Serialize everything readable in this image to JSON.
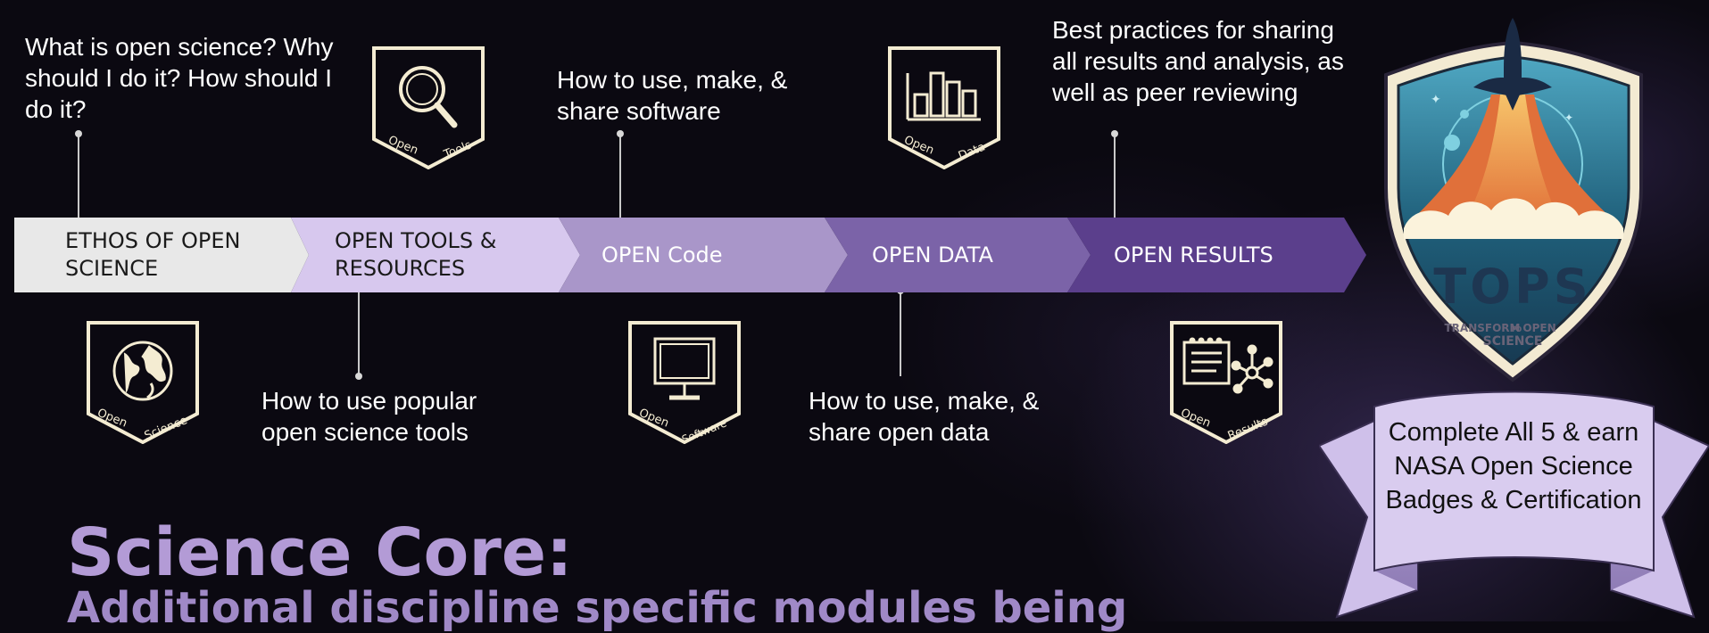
{
  "descriptions": {
    "ethos": "What is open science? Why should I do it? How should I do it?",
    "tools": "How to use popular open science tools",
    "code": "How to use, make, & share software",
    "data": "How to use, make, & share open data",
    "results": "Best practices for sharing all results and analysis, as well as peer reviewing"
  },
  "steps": [
    {
      "label_line1": "ETHOS OF OPEN",
      "label_line2": "SCIENCE",
      "color": "#e8e8e8",
      "text_color": "#1a1a1a"
    },
    {
      "label_line1": "OPEN TOOLS &",
      "label_line2": "RESOURCES",
      "color": "#d7c8ee",
      "text_color": "#1a1a1a"
    },
    {
      "label": "OPEN Code",
      "color": "#a996c9",
      "text_color": "#ffffff"
    },
    {
      "label": "OPEN DATA",
      "color": "#7b63a8",
      "text_color": "#ffffff"
    },
    {
      "label": "OPEN RESULTS",
      "color": "#5b3f8c",
      "text_color": "#ffffff"
    }
  ],
  "badges": {
    "science": {
      "word1": "Open",
      "word2": "Science",
      "icon": "globe-icon"
    },
    "tools": {
      "word1": "Open",
      "word2": "Tools",
      "icon": "magnifier-icon"
    },
    "software": {
      "word1": "Open",
      "word2": "Software",
      "icon": "monitor-icon"
    },
    "data": {
      "word1": "Open",
      "word2": "Data",
      "icon": "bar-chart-icon"
    },
    "results": {
      "word1": "Open",
      "word2": "Results",
      "icon": "document-network-icon"
    }
  },
  "tops_badge": {
    "word": "TOPS",
    "tagline_1": "TRANSFORM",
    "tagline_small": "TO",
    "tagline_2": "OPEN",
    "tagline_3": "SCIENCE",
    "icon": "rocket-icon"
  },
  "ribbon": {
    "text": "Complete All 5 & earn NASA Open Science Badges & Certification"
  },
  "title": "Science Core:",
  "subtitle": "Additional discipline specific modules being",
  "colors": {
    "badge_border": "#f4ecd2",
    "title": "#b39bd6",
    "ribbon": "#d9ccef"
  }
}
